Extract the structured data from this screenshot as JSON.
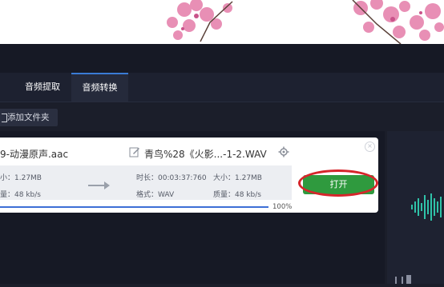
{
  "tabs": [
    {
      "label": "音频提取"
    },
    {
      "label": "音频转换"
    }
  ],
  "toolbar": {
    "add_folder_label": "添加文件夹"
  },
  "source": {
    "name": "9-动漫原声.aac",
    "size_label": "小：1.27MB",
    "quality_label": "量：48 kb/s"
  },
  "output": {
    "name": "青鸟%28《火影...-1-2.WAV",
    "duration_label": "时长：00:03:37:760",
    "format_label": "格式：WAV",
    "size_label": "大小：1.27MB",
    "quality_label": "质量：48 kb/s"
  },
  "progress": {
    "value": 100,
    "label": "100%"
  },
  "actions": {
    "open_label": "打开"
  },
  "colors": {
    "accent": "#3d6fd6",
    "open_button": "#2f9a3e",
    "highlight_ring": "#d6252b"
  }
}
